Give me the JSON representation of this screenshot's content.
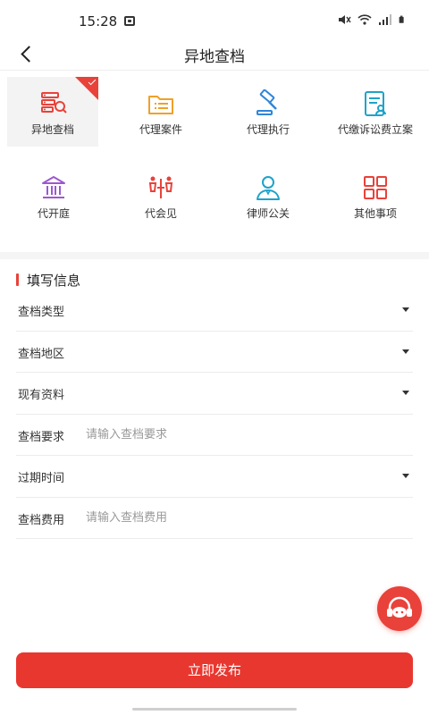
{
  "status_bar": {
    "time": "15:28"
  },
  "header": {
    "title": "异地查档"
  },
  "services": [
    {
      "label": "异地查档",
      "icon": "archive-search-icon",
      "selected": true
    },
    {
      "label": "代理案件",
      "icon": "folder-list-icon"
    },
    {
      "label": "代理执行",
      "icon": "gavel-icon"
    },
    {
      "label": "代缴诉讼费立案",
      "icon": "document-person-icon"
    },
    {
      "label": "代开庭",
      "icon": "courthouse-icon"
    },
    {
      "label": "代会见",
      "icon": "meeting-icon"
    },
    {
      "label": "律师公关",
      "icon": "lawyer-icon"
    },
    {
      "label": "其他事项",
      "icon": "grid-icon"
    }
  ],
  "form": {
    "section_title": "填写信息",
    "rows": [
      {
        "label": "查档类型",
        "type": "select"
      },
      {
        "label": "查档地区",
        "type": "select"
      },
      {
        "label": "现有资料",
        "type": "select"
      },
      {
        "label": "查档要求",
        "type": "input",
        "placeholder": "请输入查档要求"
      },
      {
        "label": "过期时间",
        "type": "select"
      },
      {
        "label": "查档费用",
        "type": "input",
        "placeholder": "请输入查档费用"
      }
    ]
  },
  "actions": {
    "publish_label": "立即发布"
  },
  "colors": {
    "accent": "#e8423a",
    "icon_red": "#e8423a",
    "icon_orange": "#f0a028",
    "icon_blue": "#2f86d8",
    "icon_cyan": "#1ea3c9",
    "icon_purple": "#9b59d0"
  }
}
